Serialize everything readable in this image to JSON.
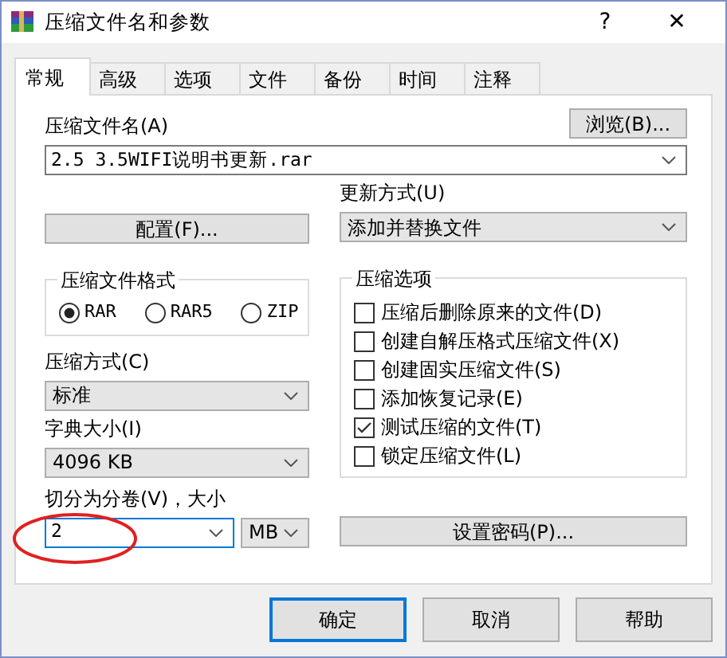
{
  "window": {
    "title": "压缩文件名和参数",
    "help": "?",
    "close": "✕"
  },
  "tabs": [
    {
      "label": "常规",
      "selected": true
    },
    {
      "label": "高级",
      "selected": false
    },
    {
      "label": "选项",
      "selected": false
    },
    {
      "label": "文件",
      "selected": false
    },
    {
      "label": "备份",
      "selected": false
    },
    {
      "label": "时间",
      "selected": false
    },
    {
      "label": "注释",
      "selected": false
    }
  ],
  "archive_name": {
    "label": "压缩文件名(A)",
    "browse": "浏览(B)...",
    "value": "2.5 3.5WIFI说明书更新.rar"
  },
  "profiles_button": "配置(F)...",
  "update_mode": {
    "label": "更新方式(U)",
    "value": "添加并替换文件"
  },
  "archive_format": {
    "title": "压缩文件格式",
    "options": [
      {
        "label": "RAR",
        "selected": true
      },
      {
        "label": "RAR5",
        "selected": false
      },
      {
        "label": "ZIP",
        "selected": false
      }
    ]
  },
  "compression_method": {
    "label": "压缩方式(C)",
    "value": "标准"
  },
  "dictionary_size": {
    "label": "字典大小(I)",
    "value": "4096 KB"
  },
  "split_volumes": {
    "label": "切分为分卷(V)，大小",
    "value": "2",
    "unit": "MB",
    "focused": true
  },
  "archiving_options": {
    "title": "压缩选项",
    "items": [
      {
        "label": "压缩后删除原来的文件(D)",
        "checked": false
      },
      {
        "label": "创建自解压格式压缩文件(X)",
        "checked": false
      },
      {
        "label": "创建固实压缩文件(S)",
        "checked": false
      },
      {
        "label": "添加恢复记录(E)",
        "checked": false
      },
      {
        "label": "测试压缩的文件(T)",
        "checked": true
      },
      {
        "label": "锁定压缩文件(L)",
        "checked": false
      }
    ]
  },
  "password_button": "设置密码(P)...",
  "buttons": [
    {
      "label": "确定",
      "default": true
    },
    {
      "label": "取消",
      "default": false
    },
    {
      "label": "帮助",
      "default": false
    }
  ]
}
